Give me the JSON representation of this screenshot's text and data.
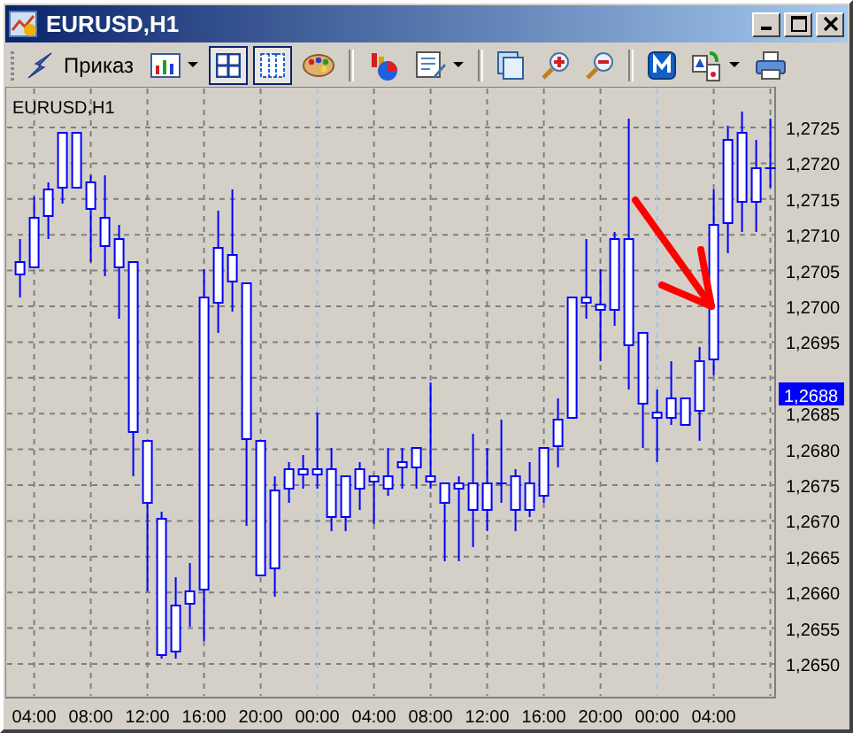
{
  "window": {
    "title": "EURUSD,H1"
  },
  "toolbar": {
    "order_button": {
      "label": "Приказ"
    },
    "toggles": [
      {
        "selected": true
      },
      {
        "selected": true
      }
    ]
  },
  "chart": {
    "symbol_label": "EURUSD,H1",
    "price_axis_upper": [
      "1,2725",
      "1,2720",
      "1,2715",
      "1,2710",
      "1,2705",
      "1,2700",
      "1,2695"
    ],
    "price_axis_lower": [
      "1,2685",
      "1,2680",
      "1,2675",
      "1,2670",
      "1,2665",
      "1,2660",
      "1,2655",
      "1,2650"
    ],
    "current_price": "1,2688",
    "time_axis": [
      "04:00",
      "08:00",
      "12:00",
      "16:00",
      "20:00",
      "00:00",
      "04:00",
      "08:00",
      "12:00",
      "16:00",
      "20:00",
      "00:00",
      "04:00"
    ]
  }
}
